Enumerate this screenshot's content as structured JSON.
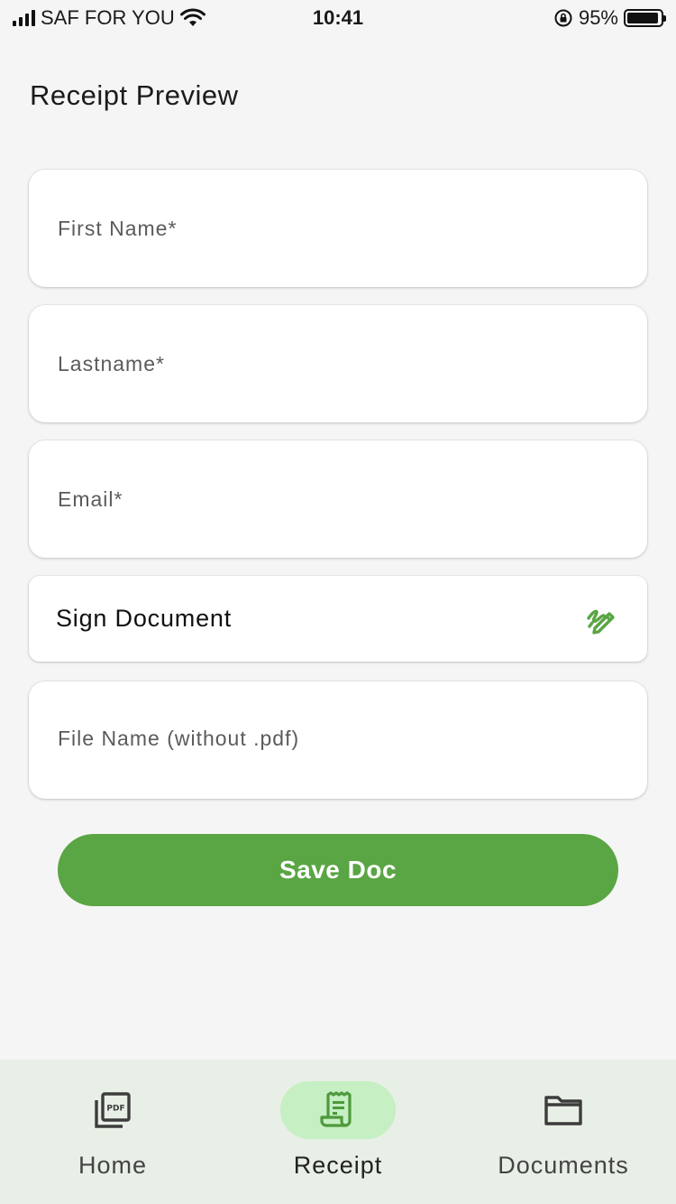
{
  "status_bar": {
    "carrier": "SAF FOR YOU",
    "time": "10:41",
    "battery_percent": "95%",
    "battery_level": 0.95
  },
  "header": {
    "title": "Receipt Preview"
  },
  "form": {
    "first_name": {
      "placeholder": "First Name*",
      "value": ""
    },
    "last_name": {
      "placeholder": "Lastname*",
      "value": ""
    },
    "email": {
      "placeholder": "Email*",
      "value": ""
    },
    "sign": {
      "label": "Sign Document",
      "icon": "signature-icon"
    },
    "file_name": {
      "placeholder": "File Name (without .pdf)",
      "value": ""
    }
  },
  "save_button": {
    "label": "Save Doc"
  },
  "bottom_nav": {
    "items": [
      {
        "label": "Home",
        "icon": "pdf-icon",
        "active": false
      },
      {
        "label": "Receipt",
        "icon": "receipt-icon",
        "active": true
      },
      {
        "label": "Documents",
        "icon": "folder-icon",
        "active": false
      }
    ]
  },
  "colors": {
    "accent": "#5aa544",
    "nav_background": "#e8efe6",
    "active_pill": "#c6efc4",
    "page_background": "#f5f5f5"
  }
}
